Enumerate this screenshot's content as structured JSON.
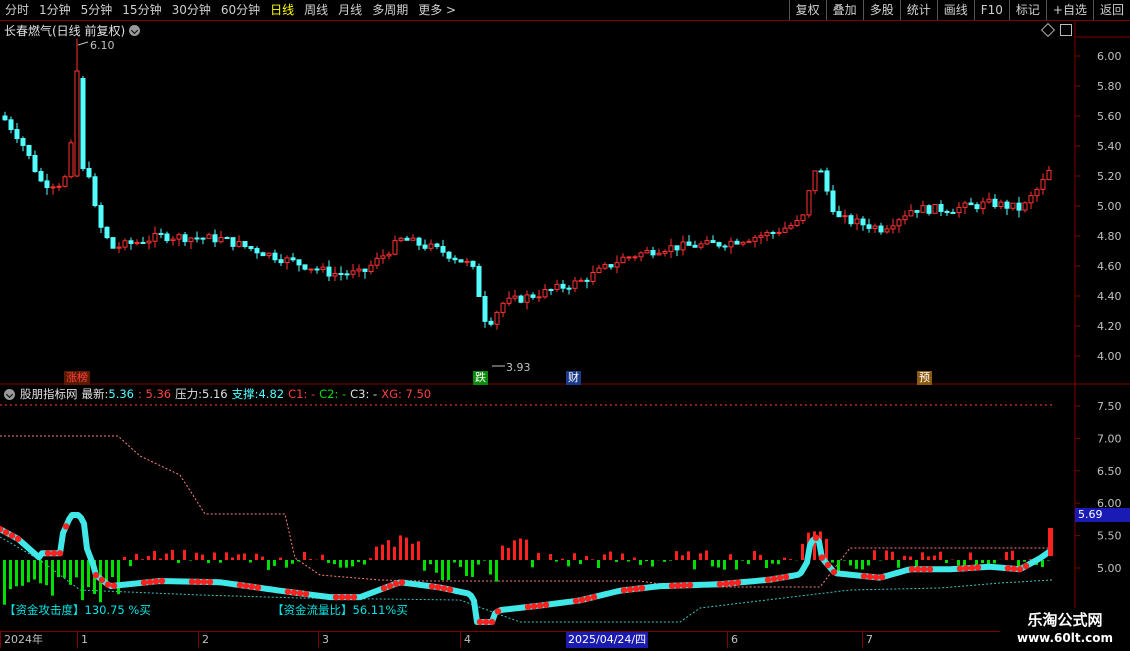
{
  "toolbar": {
    "periods": [
      "分时",
      "1分钟",
      "5分钟",
      "15分钟",
      "30分钟",
      "60分钟",
      "日线",
      "周线",
      "月线",
      "多周期",
      "更多 >"
    ],
    "active": "日线",
    "right_buttons": [
      "复权",
      "叠加",
      "多股",
      "统计",
      "画线",
      "F10",
      "标记",
      "+自选",
      "返回"
    ]
  },
  "stock": {
    "title": "长春燃气(日线 前复权)"
  },
  "price_axis": [
    "6.00",
    "5.80",
    "5.60",
    "5.40",
    "5.20",
    "5.00",
    "4.80",
    "4.60",
    "4.40",
    "4.20",
    "4.00"
  ],
  "high_label": "6.10",
  "low_label": "3.93",
  "events": {
    "limit_up": "涨榜",
    "drop": "跌",
    "finance": "财",
    "forecast": "预"
  },
  "indicator": {
    "name": "股朋指标网",
    "latest_label": "最新:",
    "latest_value": "5.36",
    "latest_value2": ": 5.36",
    "pressure_label": "压力:",
    "pressure_value": "5.16",
    "support_label": "支撑:",
    "support_value": "4.82",
    "c1": "C1: -",
    "c2": "C2: -",
    "c3": "C3: -",
    "xg": "XG: 7.50"
  },
  "indicator_axis": [
    "7.50",
    "7.00",
    "6.50",
    "6.00",
    "5.50",
    "5.00"
  ],
  "current_price_tag": "5.69",
  "bottom_labels": {
    "attack": "【资金攻击度】130.75 %买",
    "flow": "【资金流量比】56.11%买"
  },
  "date_axis": [
    "2024年",
    "1",
    "2",
    "3",
    "4",
    "6",
    "7"
  ],
  "date_highlight": "2025/04/24/四",
  "watermark": {
    "line1": "乐淘公式网",
    "line2": "www.60lt.com"
  },
  "colors": {
    "up": "#ff3232",
    "down": "#54ffff",
    "border": "#800000",
    "buy": "#ff2020",
    "sell": "#00e000"
  }
}
